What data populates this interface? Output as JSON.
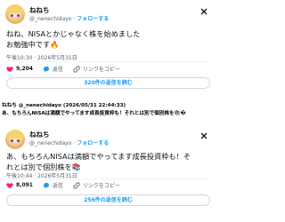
{
  "tweet1": {
    "name": "ねねち",
    "handle": "@_nenechidayo",
    "separator": "·",
    "follow_label": "フォローする",
    "text_line1": "ねね、NISAとかじゃなく株を始めました",
    "text_line2": "お勉強中です",
    "text_emoji": "🔥",
    "timestamp": "午後10:30 · 2026年5月31日",
    "likes": "9,204",
    "reply_label": "返信",
    "link_label": "リンクをコピー",
    "replies_button": "320件の返信を読む"
  },
  "caption": {
    "line1": "ねねち @_nenechidayo (2026/05/31 22:44:33)",
    "line2": "あ、もちろんNISAは満額でやってます成長投資枠も！それとは別で個別株を📚�"
  },
  "tweet2": {
    "name": "ねねち",
    "handle": "@_nenechidayo",
    "separator": "·",
    "follow_label": "フォローする",
    "text_line1": "あ、もちろんNISAは満額でやってます成長投資枠も！そ",
    "text_line2": "れとは別で個別株を",
    "text_emoji": "📚",
    "timestamp": "午後10:44 · 2026年5月31日",
    "likes": "8,091",
    "reply_label": "返信",
    "link_label": "リンクをコピー",
    "replies_button": "256件の返信を読む"
  },
  "colors": {
    "accent": "#1d9bf0",
    "like": "#f91880",
    "text": "#0f1419",
    "muted": "#536471"
  },
  "icons": [
    "x-logo-icon",
    "heart-icon",
    "reply-icon",
    "link-icon",
    "fire-emoji",
    "books-emoji"
  ]
}
